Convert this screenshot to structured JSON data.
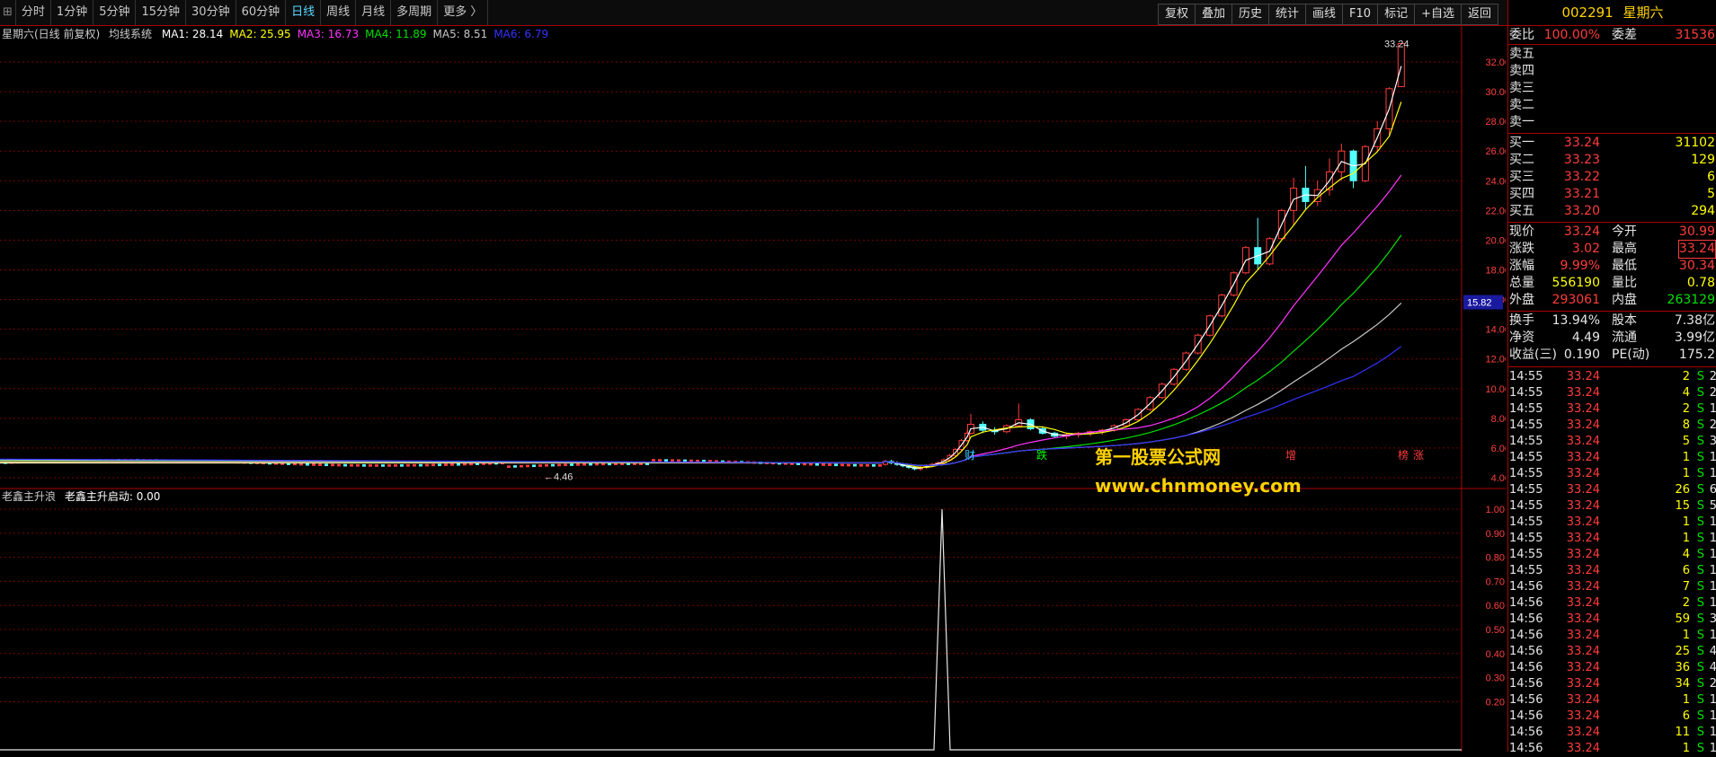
{
  "toolbar": {
    "first_tab": "⊞",
    "period_tabs": [
      "分时",
      "1分钟",
      "5分钟",
      "15分钟",
      "30分钟",
      "60分钟",
      "日线",
      "周线",
      "月线",
      "多周期",
      "更多 〉"
    ],
    "active_period": "日线",
    "right_tools": [
      "复权",
      "叠加",
      "历史",
      "统计",
      "画线",
      "F10",
      "标记",
      "+自选",
      "返回"
    ]
  },
  "main_legend": {
    "title": "星期六(日线 前复权)",
    "system": "均线系统",
    "ma_items": [
      {
        "label": "MA1: 28.14",
        "color": "#ffffff"
      },
      {
        "label": "MA2: 25.95",
        "color": "#ffff00"
      },
      {
        "label": "MA3: 16.73",
        "color": "#ff33ff"
      },
      {
        "label": "MA4: 11.89",
        "color": "#00e000"
      },
      {
        "label": "MA5: 8.51",
        "color": "#c8c8c8"
      },
      {
        "label": "MA6: 6.79",
        "color": "#3333ff"
      }
    ]
  },
  "main_axis": {
    "ticks": [
      "32.00",
      "30.00",
      "28.00",
      "26.00",
      "24.00",
      "22.00",
      "20.00",
      "18.00",
      "16.00",
      "14.00",
      "12.00",
      "10.00",
      "8.00",
      "6.00",
      "4.00"
    ],
    "current_price_tag": "15.82",
    "high_label": "33.24",
    "low_label": "4.46"
  },
  "event_markers": [
    "财",
    "跌",
    "增",
    "榜",
    "涨"
  ],
  "sub_legend": {
    "title": "老鑫主升浪",
    "item": "老鑫主升启动: 0.00"
  },
  "sub_axis": {
    "ticks": [
      "1.00",
      "0.90",
      "0.80",
      "0.70",
      "0.60",
      "0.50",
      "0.40",
      "0.30",
      "0.20"
    ]
  },
  "watermark": {
    "title": "第一股票公式网",
    "url": "www.chnmoney.com"
  },
  "colors": {
    "up": "#ff3c3c",
    "down": "#54ffff",
    "grid": "#7a0000",
    "bg": "#000000"
  },
  "chart_data": {
    "type": "candlestick",
    "ylim": [
      4,
      33
    ],
    "candles": [
      {
        "o": 4.9,
        "h": 5.2,
        "l": 4.8,
        "c": 5.1
      },
      {
        "o": 5.1,
        "h": 5.2,
        "l": 4.9,
        "c": 5.0
      },
      {
        "o": 5.0,
        "h": 5.1,
        "l": 4.8,
        "c": 4.9
      },
      {
        "o": 4.9,
        "h": 5.0,
        "l": 4.7,
        "c": 4.8
      },
      {
        "o": 4.8,
        "h": 4.9,
        "l": 4.6,
        "c": 4.7
      },
      {
        "o": 4.7,
        "h": 4.8,
        "l": 4.5,
        "c": 4.6
      },
      {
        "o": 4.6,
        "h": 4.8,
        "l": 4.46,
        "c": 4.7
      },
      {
        "o": 4.7,
        "h": 4.9,
        "l": 4.6,
        "c": 4.8
      },
      {
        "o": 4.8,
        "h": 5.0,
        "l": 4.7,
        "c": 4.9
      },
      {
        "o": 4.9,
        "h": 5.1,
        "l": 4.8,
        "c": 5.0
      },
      {
        "o": 5.0,
        "h": 5.3,
        "l": 4.9,
        "c": 5.2
      },
      {
        "o": 5.2,
        "h": 5.6,
        "l": 5.1,
        "c": 5.5
      },
      {
        "o": 5.5,
        "h": 6.0,
        "l": 5.4,
        "c": 5.9
      },
      {
        "o": 5.9,
        "h": 6.6,
        "l": 5.8,
        "c": 6.5
      },
      {
        "o": 6.5,
        "h": 7.2,
        "l": 6.4,
        "c": 7.0
      },
      {
        "o": 7.0,
        "h": 8.3,
        "l": 6.9,
        "c": 7.6
      },
      {
        "o": 7.6,
        "h": 7.8,
        "l": 7.0,
        "c": 7.2
      },
      {
        "o": 7.2,
        "h": 7.4,
        "l": 6.9,
        "c": 7.1
      },
      {
        "o": 7.1,
        "h": 7.6,
        "l": 7.0,
        "c": 7.5
      },
      {
        "o": 7.5,
        "h": 9.0,
        "l": 7.4,
        "c": 7.9
      },
      {
        "o": 7.9,
        "h": 8.0,
        "l": 7.2,
        "c": 7.3
      },
      {
        "o": 7.3,
        "h": 7.4,
        "l": 6.9,
        "c": 7.0
      },
      {
        "o": 7.0,
        "h": 7.1,
        "l": 6.7,
        "c": 6.8
      },
      {
        "o": 6.8,
        "h": 7.0,
        "l": 6.6,
        "c": 6.9
      },
      {
        "o": 6.9,
        "h": 7.1,
        "l": 6.7,
        "c": 7.0
      },
      {
        "o": 7.0,
        "h": 7.2,
        "l": 6.8,
        "c": 7.1
      },
      {
        "o": 7.1,
        "h": 7.3,
        "l": 6.9,
        "c": 7.2
      },
      {
        "o": 7.2,
        "h": 7.6,
        "l": 7.1,
        "c": 7.5
      },
      {
        "o": 7.5,
        "h": 8.0,
        "l": 7.4,
        "c": 7.9
      },
      {
        "o": 7.9,
        "h": 8.7,
        "l": 7.8,
        "c": 8.6
      },
      {
        "o": 8.6,
        "h": 9.5,
        "l": 8.5,
        "c": 9.4
      },
      {
        "o": 9.4,
        "h": 10.4,
        "l": 9.3,
        "c": 10.3
      },
      {
        "o": 10.3,
        "h": 11.4,
        "l": 10.2,
        "c": 11.3
      },
      {
        "o": 11.3,
        "h": 12.5,
        "l": 11.2,
        "c": 12.4
      },
      {
        "o": 12.4,
        "h": 13.7,
        "l": 12.3,
        "c": 13.6
      },
      {
        "o": 13.6,
        "h": 15.0,
        "l": 13.5,
        "c": 14.9
      },
      {
        "o": 14.9,
        "h": 16.4,
        "l": 14.8,
        "c": 16.3
      },
      {
        "o": 16.3,
        "h": 17.9,
        "l": 16.2,
        "c": 17.8
      },
      {
        "o": 17.8,
        "h": 19.6,
        "l": 17.7,
        "c": 19.5
      },
      {
        "o": 19.5,
        "h": 21.5,
        "l": 18.0,
        "c": 18.4
      },
      {
        "o": 18.4,
        "h": 20.2,
        "l": 18.3,
        "c": 20.1
      },
      {
        "o": 20.1,
        "h": 22.1,
        "l": 20.0,
        "c": 22.0
      },
      {
        "o": 22.0,
        "h": 24.2,
        "l": 21.0,
        "c": 23.5
      },
      {
        "o": 23.5,
        "h": 25.0,
        "l": 22.0,
        "c": 22.6
      },
      {
        "o": 22.6,
        "h": 24.0,
        "l": 22.3,
        "c": 23.4
      },
      {
        "o": 23.4,
        "h": 25.5,
        "l": 23.0,
        "c": 24.6
      },
      {
        "o": 24.6,
        "h": 26.5,
        "l": 24.0,
        "c": 26.0
      },
      {
        "o": 26.0,
        "h": 26.1,
        "l": 23.5,
        "c": 24.0
      },
      {
        "o": 24.0,
        "h": 26.4,
        "l": 23.9,
        "c": 26.3
      },
      {
        "o": 26.3,
        "h": 28.0,
        "l": 26.0,
        "c": 27.5
      },
      {
        "o": 27.5,
        "h": 30.3,
        "l": 27.0,
        "c": 30.2
      },
      {
        "o": 30.34,
        "h": 33.24,
        "l": 30.34,
        "c": 33.24
      }
    ],
    "indicator": {
      "name": "老鑫主升启动",
      "peak_value": 1.0,
      "ylim": [
        0,
        1.05
      ]
    }
  },
  "panel": {
    "code": "002291",
    "name": "星期六",
    "weibi_label": "委比",
    "weibi_value": "100.00%",
    "weicha_label": "委差",
    "weicha_value": "31536",
    "sells": [
      {
        "label": "卖五"
      },
      {
        "label": "卖四"
      },
      {
        "label": "卖三"
      },
      {
        "label": "卖二"
      },
      {
        "label": "卖一"
      }
    ],
    "buys": [
      {
        "label": "买一",
        "price": "33.24",
        "vol": "31102"
      },
      {
        "label": "买二",
        "price": "33.23",
        "vol": "129"
      },
      {
        "label": "买三",
        "price": "33.22",
        "vol": "6"
      },
      {
        "label": "买四",
        "price": "33.21",
        "vol": "5"
      },
      {
        "label": "买五",
        "price": "33.20",
        "vol": "294"
      }
    ],
    "stats": [
      {
        "l1": "现价",
        "v1": "33.24",
        "c1": "red",
        "l2": "今开",
        "v2": "30.99",
        "c2": "red"
      },
      {
        "l1": "涨跌",
        "v1": "3.02",
        "c1": "red",
        "l2": "最高",
        "v2": "33.24",
        "c2": "red"
      },
      {
        "l1": "涨幅",
        "v1": "9.99%",
        "c1": "red",
        "l2": "最低",
        "v2": "30.34",
        "c2": "red"
      },
      {
        "l1": "总量",
        "v1": "556190",
        "c1": "yellow",
        "l2": "量比",
        "v2": "0.78",
        "c2": "yellow"
      },
      {
        "l1": "外盘",
        "v1": "293061",
        "c1": "red",
        "l2": "内盘",
        "v2": "263129",
        "c2": "green"
      }
    ],
    "fundamentals": [
      {
        "l1": "换手",
        "v1": "13.94%",
        "l2": "股本",
        "v2": "7.38亿"
      },
      {
        "l1": "净资",
        "v1": "4.49",
        "l2": "流通",
        "v2": "3.99亿"
      },
      {
        "l1": "收益(三)",
        "v1": "0.190",
        "l2": "PE(动)",
        "v2": "175.2"
      }
    ],
    "ticks": [
      {
        "t": "14:55",
        "p": "33.24",
        "v": "2",
        "s": "S",
        "n": "2"
      },
      {
        "t": "14:55",
        "p": "33.24",
        "v": "4",
        "s": "S",
        "n": "2"
      },
      {
        "t": "14:55",
        "p": "33.24",
        "v": "2",
        "s": "S",
        "n": "1"
      },
      {
        "t": "14:55",
        "p": "33.24",
        "v": "8",
        "s": "S",
        "n": "2"
      },
      {
        "t": "14:55",
        "p": "33.24",
        "v": "5",
        "s": "S",
        "n": "3"
      },
      {
        "t": "14:55",
        "p": "33.24",
        "v": "1",
        "s": "S",
        "n": "1"
      },
      {
        "t": "14:55",
        "p": "33.24",
        "v": "1",
        "s": "S",
        "n": "1"
      },
      {
        "t": "14:55",
        "p": "33.24",
        "v": "26",
        "s": "S",
        "n": "6"
      },
      {
        "t": "14:55",
        "p": "33.24",
        "v": "15",
        "s": "S",
        "n": "5"
      },
      {
        "t": "14:55",
        "p": "33.24",
        "v": "1",
        "s": "S",
        "n": "1"
      },
      {
        "t": "14:55",
        "p": "33.24",
        "v": "1",
        "s": "S",
        "n": "1"
      },
      {
        "t": "14:55",
        "p": "33.24",
        "v": "4",
        "s": "S",
        "n": "1"
      },
      {
        "t": "14:55",
        "p": "33.24",
        "v": "6",
        "s": "S",
        "n": "1"
      },
      {
        "t": "14:56",
        "p": "33.24",
        "v": "7",
        "s": "S",
        "n": "1"
      },
      {
        "t": "14:56",
        "p": "33.24",
        "v": "2",
        "s": "S",
        "n": "1"
      },
      {
        "t": "14:56",
        "p": "33.24",
        "v": "59",
        "s": "S",
        "n": "3"
      },
      {
        "t": "14:56",
        "p": "33.24",
        "v": "1",
        "s": "S",
        "n": "1"
      },
      {
        "t": "14:56",
        "p": "33.24",
        "v": "25",
        "s": "S",
        "n": "4"
      },
      {
        "t": "14:56",
        "p": "33.24",
        "v": "36",
        "s": "S",
        "n": "4"
      },
      {
        "t": "14:56",
        "p": "33.24",
        "v": "34",
        "s": "S",
        "n": "2"
      },
      {
        "t": "14:56",
        "p": "33.24",
        "v": "1",
        "s": "S",
        "n": "1"
      },
      {
        "t": "14:56",
        "p": "33.24",
        "v": "6",
        "s": "S",
        "n": "1"
      },
      {
        "t": "14:56",
        "p": "33.24",
        "v": "11",
        "s": "S",
        "n": "1"
      },
      {
        "t": "14:56",
        "p": "33.24",
        "v": "1",
        "s": "S",
        "n": "1"
      }
    ]
  }
}
